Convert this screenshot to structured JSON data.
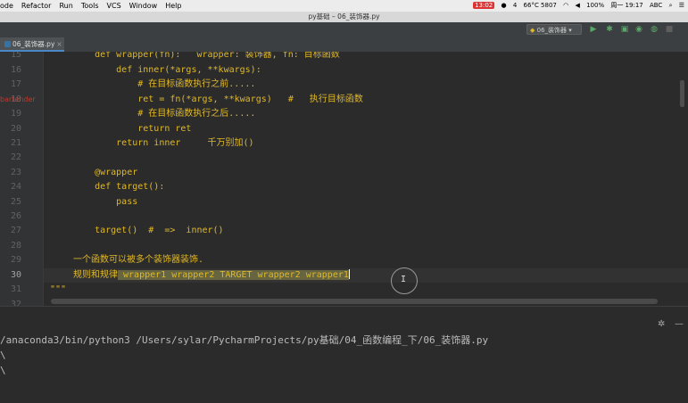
{
  "menubar": {
    "menus": [
      "ode",
      "Refactor",
      "Run",
      "Tools",
      "VCS",
      "Window",
      "Help"
    ],
    "rec_time": "13:02",
    "tray": [
      "4",
      "66°C 5807",
      "100%",
      "周一 19:17",
      "ABC"
    ]
  },
  "window": {
    "title": "py基础 – 06_装饰器.py"
  },
  "toolbar": {
    "run_config_label": "06_装饰器"
  },
  "tabs": [
    {
      "label": "06_装饰器.py",
      "close": "×"
    }
  ],
  "editor": {
    "gutter_annotation": "bartender",
    "lines": [
      {
        "num": "15",
        "text": "    def wrapper(fn):   wrapper: 装饰器, fn: 目标函数"
      },
      {
        "num": "16",
        "text": "        def inner(*args, **kwargs):"
      },
      {
        "num": "17",
        "text": "            # 在目标函数执行之前....."
      },
      {
        "num": "18",
        "text": "            ret = fn(*args, **kwargs)   #   执行目标函数"
      },
      {
        "num": "19",
        "text": "            # 在目标函数执行之后....."
      },
      {
        "num": "20",
        "text": "            return ret"
      },
      {
        "num": "21",
        "text": "        return inner     千万别加()"
      },
      {
        "num": "22",
        "text": ""
      },
      {
        "num": "23",
        "text": "    @wrapper"
      },
      {
        "num": "24",
        "text": "    def target():"
      },
      {
        "num": "25",
        "text": "        pass"
      },
      {
        "num": "26",
        "text": ""
      },
      {
        "num": "27",
        "text": "    target()  #  =>  inner()"
      },
      {
        "num": "28",
        "text": ""
      },
      {
        "num": "29",
        "text": "一个函数可以被多个装饰器装饰."
      },
      {
        "num": "30",
        "text": "规则和规律"
      },
      {
        "num": "31",
        "text": "\"\"\""
      },
      {
        "num": "32",
        "text": ""
      }
    ],
    "selected_text": " wrapper1 wrapper2 TARGET wrapper2 wrapper1"
  },
  "console": {
    "lines": [
      "/anaconda3/bin/python3 /Users/sylar/PycharmProjects/py基础/04_函数编程_下/06_装饰器.py",
      "\\",
      "\\"
    ]
  },
  "colors": {
    "editor_bg": "#2b2b2b",
    "code_fg": "#e0b826",
    "selection": "#66653f",
    "run_green": "#59a869"
  }
}
